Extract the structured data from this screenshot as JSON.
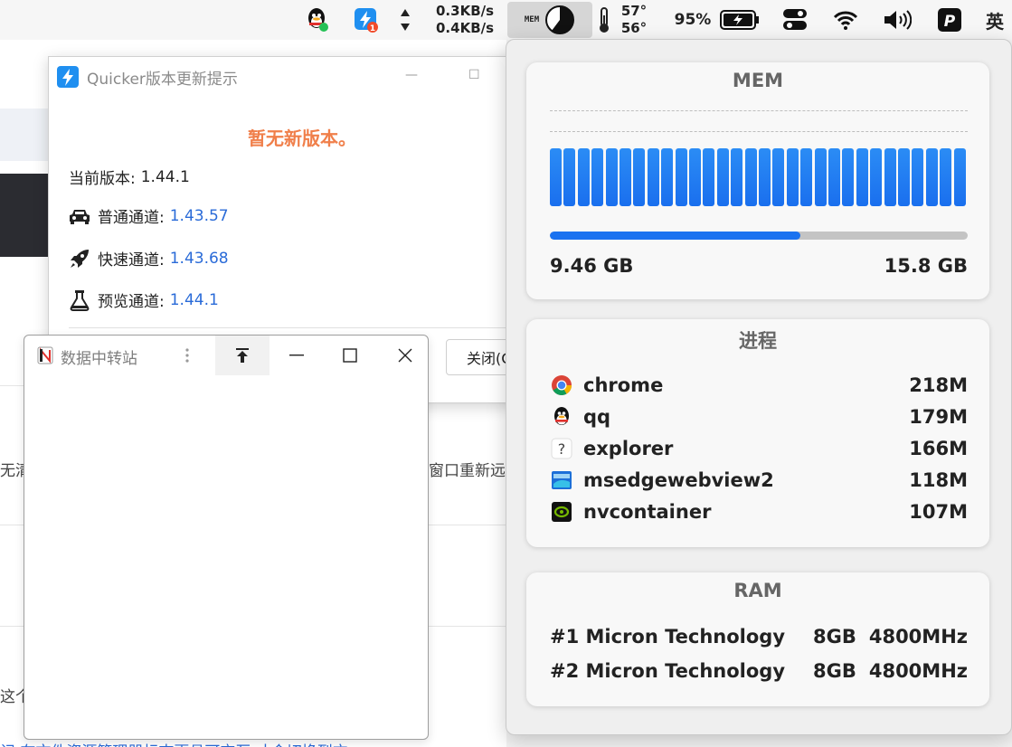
{
  "menubar": {
    "net_up": "0.3KB/s",
    "net_down": "0.4KB/s",
    "mem_label": "MEM",
    "temp_1": "57°",
    "temp_2": "56°",
    "battery": "95%",
    "quicker_badge": "1",
    "ime": "英",
    "icons": [
      "qq-icon",
      "quicker-icon",
      "updown-arrows-icon",
      "mem-pie-icon",
      "thermometer-icon",
      "battery-icon",
      "toggle-icon",
      "wifi-icon",
      "volume-icon",
      "pp-icon"
    ]
  },
  "background": {
    "left_text_1": "无清",
    "right_text_1": "窗口重新远",
    "left_text_2": "这个",
    "bottom_text": "记 在文件资源管理器标志更具可交互 才会切换到方"
  },
  "quicker": {
    "title": "Quicker版本更新提示",
    "status": "暂无新版本。",
    "current_label": "当前版本:",
    "current_version": "1.44.1",
    "channels": [
      {
        "label": "普通通道:",
        "version": "1.43.57",
        "icon": "car-icon"
      },
      {
        "label": "快速通道:",
        "version": "1.43.68",
        "icon": "rocket-icon"
      },
      {
        "label": "预览通道:",
        "version": "1.44.1",
        "icon": "flask-icon"
      }
    ],
    "close_label": "关闭(C)"
  },
  "relay": {
    "title": "数据中转站"
  },
  "mem_panel": {
    "mem_title": "MEM",
    "used": "9.46 GB",
    "total": "15.8 GB",
    "used_fraction": 0.6,
    "bar_count": 30,
    "process_title": "进程",
    "processes": [
      {
        "name": "chrome",
        "mem": "218M",
        "icon": "chrome-icon"
      },
      {
        "name": "qq",
        "mem": "179M",
        "icon": "qq-icon"
      },
      {
        "name": "explorer",
        "mem": "166M",
        "icon": "question-icon"
      },
      {
        "name": "msedgewebview2",
        "mem": "118M",
        "icon": "edge-webview-icon"
      },
      {
        "name": "nvcontainer",
        "mem": "107M",
        "icon": "nvidia-icon"
      }
    ],
    "ram_title": "RAM",
    "ram": [
      {
        "name": "#1 Micron Technology",
        "size": "8GB",
        "speed": "4800MHz"
      },
      {
        "name": "#2 Micron Technology",
        "size": "8GB",
        "speed": "4800MHz"
      }
    ]
  },
  "colors": {
    "accent_blue": "#1a73f0",
    "orange_status": "#f07f4a",
    "link_blue": "#2a6bd8"
  }
}
